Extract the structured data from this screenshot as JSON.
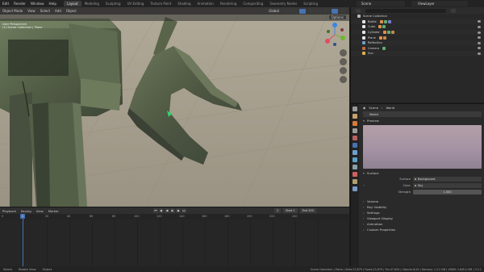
{
  "topbar": {
    "menus": [
      "Edit",
      "Render",
      "Window",
      "Help"
    ],
    "tabs": [
      "Layout",
      "Modeling",
      "Sculpting",
      "UV Editing",
      "Texture Paint",
      "Shading",
      "Animation",
      "Rendering",
      "Compositing",
      "Geometry Nodes",
      "Scripting"
    ],
    "active_tab": "Layout",
    "scene": "Scene",
    "view_layer": "ViewLayer"
  },
  "viewport": {
    "mode": "Object Mode",
    "menus": [
      "View",
      "Select",
      "Add",
      "Object"
    ],
    "transform_orientation": "Global",
    "view_name": "User Perspective",
    "collection_info": "(1) Scene Collection | Plane",
    "options_label": "Options",
    "background_color": "#a59d8c",
    "gizmo_colors": {
      "x": "#e44b5d",
      "y": "#6fb72e",
      "z": "#3c84e4"
    }
  },
  "timeline": {
    "menus": [
      "Playback",
      "Keying",
      "View",
      "Marker"
    ],
    "current_frame": "1",
    "start_label": "Start",
    "start": "1",
    "end_label": "End",
    "end": "250",
    "ticks": [
      "0",
      "20",
      "40",
      "60",
      "80",
      "100",
      "120",
      "140",
      "160",
      "180",
      "200",
      "220",
      "240"
    ],
    "playback_icons": [
      "jump-start",
      "prev-key",
      "play-reverse",
      "play",
      "next-key",
      "jump-end"
    ]
  },
  "statusbar": {
    "left_items": [
      "Select",
      "Rotate View",
      "Object"
    ],
    "right_text": "Scene Collection | Plane | Verts:23,879 | Faces:23,879 | Tris:47,620 | Objects:0/10 | Memory: 1.21 GiB | VRAM: 2.6/8.0 GiB | 3.2.1"
  },
  "outliner": {
    "rows": [
      {
        "label": "Scene Collection",
        "indent": 0,
        "icon_color": "#b8b8b8"
      },
      {
        "label": "Bottle",
        "indent": 1,
        "icon_color": "#e5e5e5",
        "badges": [
          "#e0914a",
          "#5fae6e",
          "#7c7cd4"
        ]
      },
      {
        "label": "Cube",
        "indent": 1,
        "icon_color": "#e5e5e5",
        "badges": [
          "#e0914a",
          "#5fae6e"
        ]
      },
      {
        "label": "Cylinder",
        "indent": 1,
        "icon_color": "#e5e5e5",
        "badges": [
          "#e0914a",
          "#5fae6e",
          "#c48a4a"
        ]
      },
      {
        "label": "Plane",
        "indent": 1,
        "icon_color": "#e5e5e5",
        "badges": [
          "#e0914a",
          "#c48a4a"
        ]
      },
      {
        "label": "Reflection",
        "indent": 1,
        "icon_color": "#6fa0c8",
        "badges": []
      },
      {
        "label": "Camera",
        "indent": 1,
        "icon_color": "#c0694a",
        "badges": [
          "#5fae6e"
        ]
      },
      {
        "label": "Sun",
        "indent": 1,
        "icon_color": "#d8b34a",
        "badges": []
      }
    ]
  },
  "properties": {
    "breadcrumb": [
      "Scene",
      "World"
    ],
    "world_name": "World",
    "tab_colors": [
      "#9a9a9a",
      "#c8a26a",
      "#d87a3a",
      "#9a9a9a",
      "#b86060",
      "#c45050",
      "#6aa0d0",
      "#5aa0c8",
      "#8aa0a8",
      "#d06060",
      "#b0a070",
      "#7a9ac8"
    ],
    "active_tab_index": 5,
    "preview_label": "Preview",
    "surface_panel": "Surface",
    "surface_label": "Surface",
    "surface_value": "Background",
    "color_label": "Color",
    "color_value": "Sky",
    "strength_label": "Strength",
    "strength_value": "1.000",
    "collapsed_panels": [
      "Volume",
      "Ray Visibility",
      "Settings",
      "Viewport Display",
      "Animation",
      "Custom Properties"
    ]
  }
}
